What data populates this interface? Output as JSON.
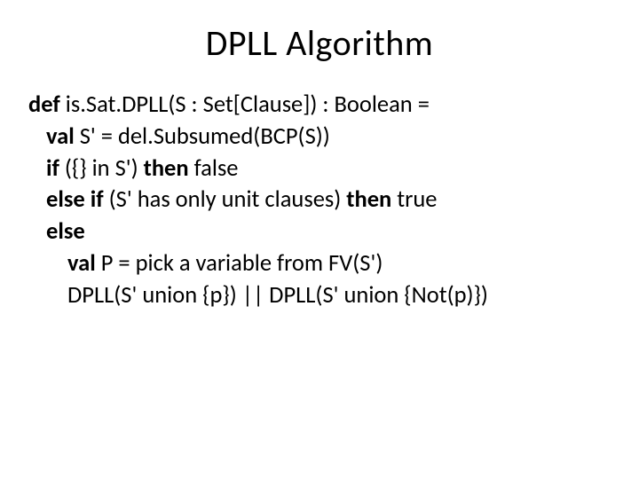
{
  "title": "DPLL Algorithm",
  "code": {
    "l1_def": "def",
    "l1_rest": " is.Sat.DPLL(S : Set[Clause]) : Boolean =",
    "l2_val": "val",
    "l2_rest": " S' = del.Subsumed(BCP(S))",
    "l3_if": "if",
    "l3_mid": " ({} in S') ",
    "l3_then": "then",
    "l3_rest": " false",
    "l4_elseif": "else if",
    "l4_mid": " (S' has only unit clauses) ",
    "l4_then": "then",
    "l4_rest": " true",
    "l5_else": "else",
    "l6_val": "val",
    "l6_rest": " P = pick a variable from FV(S')",
    "l7": "DPLL(S' union {p})  || DPLL(S' union {Not(p)})"
  }
}
